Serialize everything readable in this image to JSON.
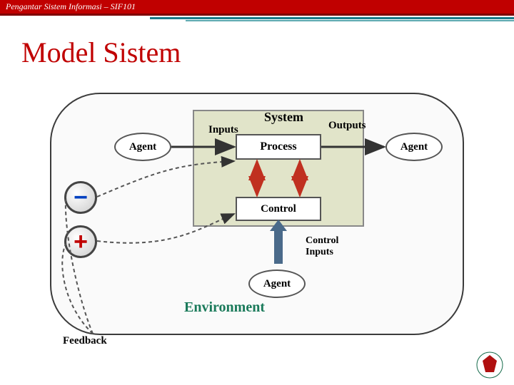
{
  "header": {
    "course": "Pengantar Sistem Informasi – SIF101"
  },
  "slide": {
    "title": "Model Sistem"
  },
  "diagram": {
    "system_label": "System",
    "inputs_label": "Inputs",
    "outputs_label": "Outputs",
    "process_label": "Process",
    "control_label": "Control",
    "control_inputs_line1": "Control",
    "control_inputs_line2": "Inputs",
    "agent_left": "Agent",
    "agent_right": "Agent",
    "agent_bottom": "Agent",
    "environment_label": "Environment",
    "feedback_label": "Feedback",
    "minus_symbol": "−",
    "plus_symbol": "+"
  }
}
